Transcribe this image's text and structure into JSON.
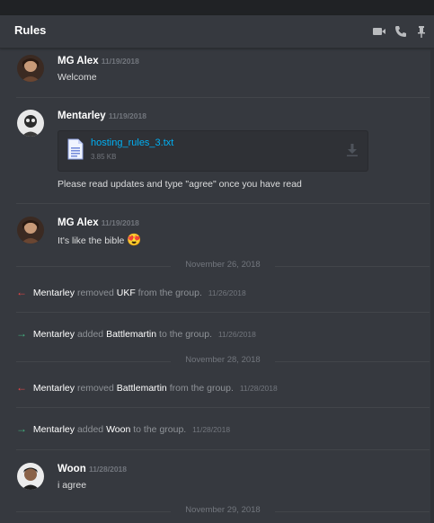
{
  "channel": {
    "title": "Rules"
  },
  "header_icons": [
    "video-call-icon",
    "phone-call-icon",
    "pin-icon"
  ],
  "messages": [
    {
      "author": "MG Alex",
      "timestamp": "11/19/2018",
      "text": "Welcome"
    },
    {
      "author": "Mentarley",
      "timestamp": "11/19/2018",
      "attachment": {
        "filename": "hosting_rules_3.txt",
        "size": "3.85 KB"
      },
      "text": "Please read updates and type \"agree\" once you have read"
    },
    {
      "author": "MG Alex",
      "timestamp": "11/19/2018",
      "text": "It's like the bible",
      "emoji": "😍"
    }
  ],
  "dates": [
    "November 26, 2018",
    "November 28, 2018",
    "November 29, 2018"
  ],
  "system": [
    {
      "actor": "Mentarley",
      "action": "removed",
      "target": "UKF",
      "suffix": "from the group.",
      "timestamp": "11/26/2018",
      "arrow": "←"
    },
    {
      "actor": "Mentarley",
      "action": "added",
      "target": "Battlemartin",
      "suffix": "to the group.",
      "timestamp": "11/26/2018",
      "arrow": "→"
    },
    {
      "actor": "Mentarley",
      "action": "removed",
      "target": "Battlemartin",
      "suffix": "from the group.",
      "timestamp": "11/28/2018",
      "arrow": "←"
    },
    {
      "actor": "Mentarley",
      "action": "added",
      "target": "Woon",
      "suffix": "to the group.",
      "timestamp": "11/28/2018",
      "arrow": "→"
    }
  ],
  "last_message": {
    "author": "Woon",
    "timestamp": "11/28/2018",
    "text": "i agree"
  },
  "colors": {
    "remove_arrow": "#f04747",
    "add_arrow": "#43b581",
    "link": "#00b0f4"
  }
}
